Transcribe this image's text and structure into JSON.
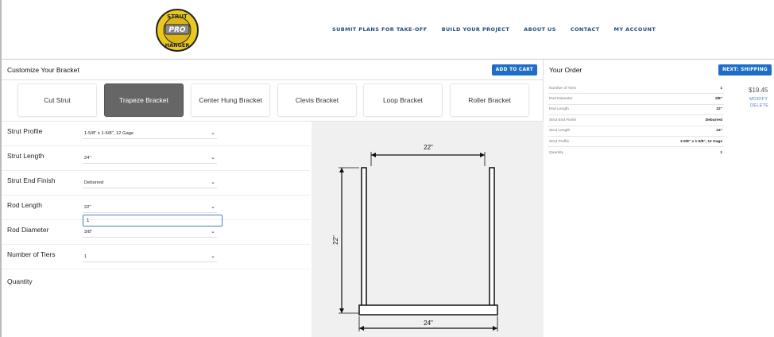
{
  "header": {
    "logo_text": [
      "STRUT",
      "PRO",
      "HANGER"
    ],
    "nav": [
      "SUBMIT PLANS FOR TAKE-OFF",
      "BUILD YOUR PROJECT",
      "ABOUT US",
      "CONTACT",
      "MY ACCOUNT"
    ]
  },
  "customize": {
    "title": "Customize Your Bracket",
    "add_to_cart": "ADD TO CART",
    "bracket_types": [
      "Cut Strut",
      "Trapeze Bracket",
      "Center Hung Bracket",
      "Clevis Bracket",
      "Loop Bracket",
      "Roller Bracket"
    ],
    "selected_type": "Trapeze Bracket"
  },
  "form": {
    "strut_profile": {
      "label": "Strut Profile",
      "value": "1-5/8\" x 1-5/8\", 12 Gage"
    },
    "strut_length": {
      "label": "Strut Length",
      "value": "24\""
    },
    "strut_end_finish": {
      "label": "Strut End Finish",
      "value": "Deburred"
    },
    "rod_length": {
      "label": "Rod Length",
      "value": "22\""
    },
    "rod_diameter": {
      "label": "Rod Diameter",
      "value": "3/8\""
    },
    "number_of_tiers": {
      "label": "Number of Tiers",
      "value": "1"
    },
    "quantity": {
      "label": "Quantity",
      "value": "1"
    }
  },
  "diagram": {
    "top_dim": "22\"",
    "side_dim": "22\"",
    "bottom_dim": "24\""
  },
  "order": {
    "title": "Your Order",
    "next_button": "NEXT: SHIPPING",
    "rows": [
      {
        "k": "Number of Tiers",
        "v": "1"
      },
      {
        "k": "Rod Diameter",
        "v": "3/8\""
      },
      {
        "k": "Rod Length",
        "v": "22\""
      },
      {
        "k": "Strut End Finish",
        "v": "Deburred"
      },
      {
        "k": "Strut Length",
        "v": "24\""
      },
      {
        "k": "Strut Profile",
        "v": "1-5/8\" x 1-5/8\", 12 Gage"
      },
      {
        "k": "Quantity",
        "v": "1"
      }
    ],
    "price": "$19.45",
    "modify": "MODIFY",
    "delete": "DELETE"
  },
  "colors": {
    "accent": "#1e6ec8",
    "nav": "#1d4e7a",
    "logo_yellow": "#e9c91f",
    "active_tab": "#666666"
  }
}
